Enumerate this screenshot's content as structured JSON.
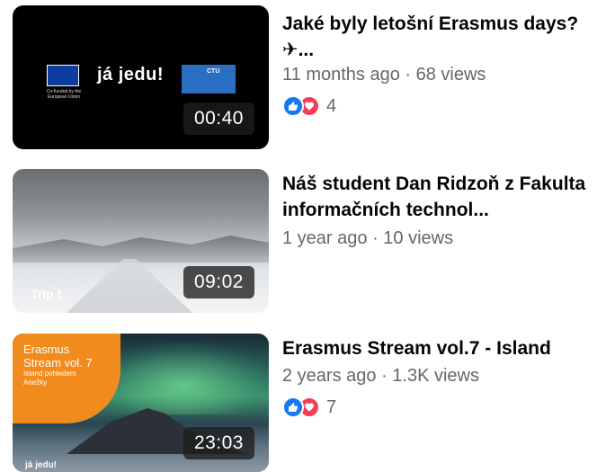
{
  "videos": [
    {
      "title": "Jaké byly letošní Erasmus days? ✈...",
      "duration": "00:40",
      "meta": "11 months ago · 68 views",
      "reactions": {
        "count": "4",
        "icons": [
          "like-icon",
          "love-icon"
        ]
      },
      "thumbnail": {
        "eu_text": "Co-funded by the European Union",
        "logo_text": "já jedu!",
        "ctu_text": "CTU"
      }
    },
    {
      "title": "Náš student Dan Ridzoň  z Fakulta informačních technol...",
      "duration": "09:02",
      "meta": "1 year ago · 10 views",
      "thumbnail": {
        "overlay_text": "Trip t"
      }
    },
    {
      "title": "Erasmus Stream vol.7 - Island",
      "duration": "23:03",
      "meta": "2 years ago · 1.3K views",
      "reactions": {
        "count": "7",
        "icons": [
          "like-icon",
          "love-icon"
        ]
      },
      "thumbnail": {
        "headline": "Erasmus\nStream vol. 7",
        "subline": "Island pohledem\nAnežky",
        "logo_text": "já jedu!"
      }
    }
  ],
  "colors": {
    "like": "#1877f2",
    "love": "#f33e58",
    "meta_text": "#65676b",
    "title_text": "#050505"
  }
}
